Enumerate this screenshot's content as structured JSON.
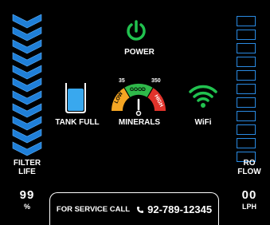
{
  "filter": {
    "label_line1": "FILTER",
    "label_line2": "LIFE",
    "value": "99",
    "unit": "%",
    "level_segments_filled": 10,
    "color": "#1f7fd8"
  },
  "power": {
    "label": "POWER",
    "icon": "power-icon",
    "color": "#21c24f"
  },
  "tank": {
    "label": "TANK FULL",
    "icon": "water-tank-icon",
    "fill_color": "#39a8ee"
  },
  "minerals": {
    "label": "MINERALS",
    "scale_low": "35",
    "scale_high": "350",
    "zone_low": "LOW",
    "zone_good": "GOOD",
    "zone_high": "HIGH",
    "colors": {
      "low": "#f5a623",
      "good": "#2fb94a",
      "high": "#e2332b"
    }
  },
  "wifi": {
    "label": "WiFi",
    "icon": "wifi-icon",
    "color": "#21c24f"
  },
  "ro_flow": {
    "label_line1": "RO",
    "label_line2": "FLOW",
    "value": "00",
    "unit": "LPH",
    "level_segments_total": 11,
    "color": "#2a8ae2"
  },
  "service": {
    "text": "FOR SERVICE CALL",
    "icon": "phone-icon",
    "phone": "92-789-12345"
  }
}
